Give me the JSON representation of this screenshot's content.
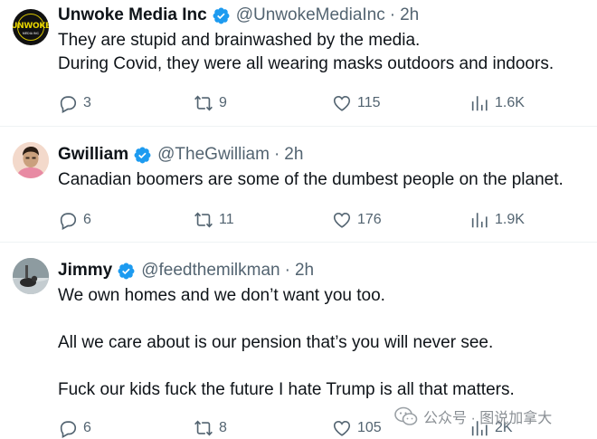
{
  "tweets": [
    {
      "name": "Unwoke Media Inc",
      "handle": "@UnwokeMediaInc",
      "time": "2h",
      "lines": [
        "They are stupid and brainwashed by the media.",
        "During Covid, they were all wearing masks outdoors and indoors."
      ],
      "avatar_text": "UNWOKE",
      "avatar_subtext": "MEDIA INC",
      "replies": "3",
      "retweets": "9",
      "likes": "115",
      "views": "1.6K"
    },
    {
      "name": "Gwilliam",
      "handle": "@TheGwilliam",
      "time": "2h",
      "lines": [
        "Canadian boomers are some of the dumbest people on the planet."
      ],
      "replies": "6",
      "retweets": "11",
      "likes": "176",
      "views": "1.9K"
    },
    {
      "name": "Jimmy",
      "handle": "@feedthemilkman",
      "time": "2h",
      "lines": [
        "We own homes and we don’t want you too.",
        "",
        "All we care about is our pension that’s you will never see.",
        "",
        "Fuck our kids fuck the future I hate Trump is all that matters."
      ],
      "replies": "6",
      "retweets": "8",
      "likes": "105",
      "views": "2K"
    }
  ],
  "separator": "·",
  "watermark": "公众号 · 图说加拿大",
  "colors": {
    "text": "#0f1419",
    "secondary": "#536471",
    "verified": "#1d9bf0",
    "divider": "#eff3f4"
  },
  "icons": [
    "reply-icon",
    "retweet-icon",
    "like-icon",
    "views-icon",
    "verified-badge-icon",
    "wechat-icon"
  ]
}
